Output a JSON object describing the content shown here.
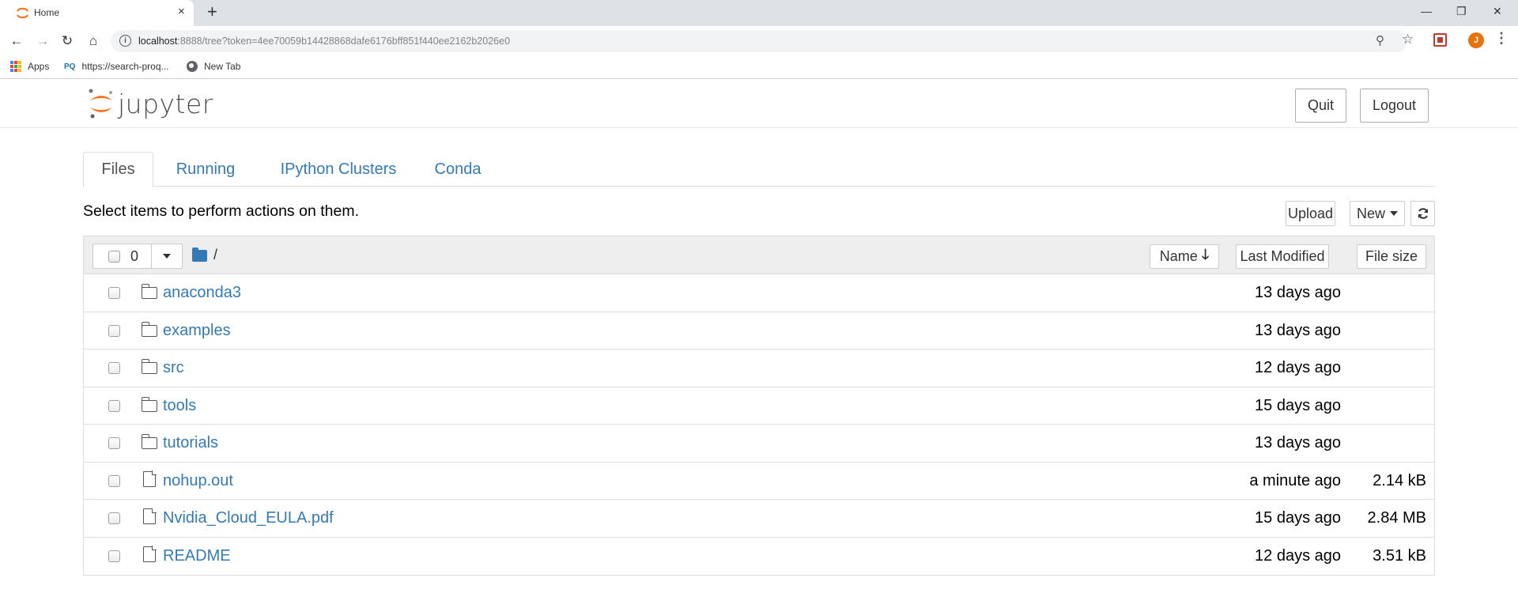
{
  "browser": {
    "tab_title": "Home",
    "tab_close": "×",
    "new_tab": "+",
    "url_host": "localhost",
    "url_rest": ":8888/tree?token=4ee70059b14428868dafe6176bff851f440ee2162b2026e0",
    "profile_initial": "J",
    "bookmarks": [
      {
        "label": "Apps",
        "icon": "apps-grid-icon"
      },
      {
        "label": "https://search-proq...",
        "icon": "pq-icon",
        "badge": "PQ"
      },
      {
        "label": "New Tab",
        "icon": "globe-icon"
      }
    ],
    "window_controls": [
      "—",
      "❐",
      "✕"
    ]
  },
  "header": {
    "logo_text": "jupyter",
    "quit_label": "Quit",
    "logout_label": "Logout"
  },
  "tabs": [
    {
      "label": "Files",
      "active": true
    },
    {
      "label": "Running",
      "active": false
    },
    {
      "label": "IPython Clusters",
      "active": false
    },
    {
      "label": "Conda",
      "active": false
    }
  ],
  "toolbar": {
    "message": "Select items to perform actions on them.",
    "upload_label": "Upload",
    "new_label": "New",
    "refresh_icon": "refresh-icon"
  },
  "list_header": {
    "selected_count": "0",
    "path": "/",
    "sort_name_label": "Name",
    "sort_modified_label": "Last Modified",
    "sort_size_label": "File size"
  },
  "items": [
    {
      "name": "anaconda3",
      "type": "folder",
      "modified": "13 days ago",
      "size": ""
    },
    {
      "name": "examples",
      "type": "folder",
      "modified": "13 days ago",
      "size": ""
    },
    {
      "name": "src",
      "type": "folder",
      "modified": "12 days ago",
      "size": ""
    },
    {
      "name": "tools",
      "type": "folder",
      "modified": "15 days ago",
      "size": ""
    },
    {
      "name": "tutorials",
      "type": "folder",
      "modified": "13 days ago",
      "size": ""
    },
    {
      "name": "nohup.out",
      "type": "file",
      "modified": "a minute ago",
      "size": "2.14 kB"
    },
    {
      "name": "Nvidia_Cloud_EULA.pdf",
      "type": "file",
      "modified": "15 days ago",
      "size": "2.84 MB"
    },
    {
      "name": "README",
      "type": "file",
      "modified": "12 days ago",
      "size": "3.51 kB"
    }
  ],
  "colors": {
    "link": "#337ab7",
    "jupyter_orange": "#f37726",
    "header_bg": "#eeeeee"
  }
}
